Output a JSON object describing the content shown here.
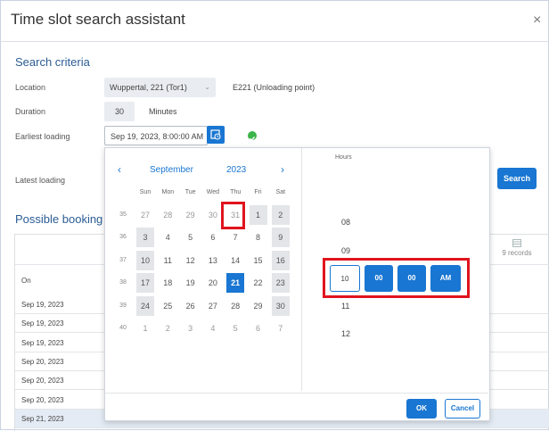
{
  "dialog": {
    "title": "Time slot search assistant",
    "close": "×"
  },
  "criteria": {
    "heading": "Search criteria",
    "location_label": "Location",
    "location_value": "Wuppertal, 221 (Tor1)",
    "location_desc": "E221 (Unloading point)",
    "duration_label": "Duration",
    "duration_value": "30",
    "duration_unit": "Minutes",
    "earliest_label": "Earliest loading",
    "earliest_value": "Sep 19, 2023, 8:00:00 AM",
    "latest_label": "Latest loading",
    "search_label": "Search"
  },
  "results": {
    "heading": "Possible booking t",
    "col_on": "On",
    "records": "9 records",
    "rows": [
      "Sep 19, 2023",
      "Sep 19, 2023",
      "Sep 19, 2023",
      "Sep 20, 2023",
      "Sep 20, 2023",
      "Sep 20, 2023",
      "Sep 21, 2023"
    ]
  },
  "calendar": {
    "prev": "‹",
    "next": "›",
    "month": "September",
    "year": "2023",
    "weekdays": [
      "Sun",
      "Mon",
      "Tue",
      "Wed",
      "Thu",
      "Fri",
      "Sat"
    ],
    "weeks": [
      {
        "no": "35",
        "days": [
          "27",
          "28",
          "29",
          "30",
          "31",
          "1",
          "2"
        ]
      },
      {
        "no": "36",
        "days": [
          "3",
          "4",
          "5",
          "6",
          "7",
          "8",
          "9"
        ]
      },
      {
        "no": "37",
        "days": [
          "10",
          "11",
          "12",
          "13",
          "14",
          "15",
          "16"
        ]
      },
      {
        "no": "38",
        "days": [
          "17",
          "18",
          "19",
          "20",
          "21",
          "22",
          "23"
        ]
      },
      {
        "no": "39",
        "days": [
          "24",
          "25",
          "26",
          "27",
          "28",
          "29",
          "30"
        ]
      },
      {
        "no": "40",
        "days": [
          "1",
          "2",
          "3",
          "4",
          "5",
          "6",
          "7"
        ]
      }
    ]
  },
  "time": {
    "hours_label": "Hours",
    "hours_above": [
      "08",
      "09"
    ],
    "hours_below": [
      "11",
      "12"
    ],
    "hour": "10",
    "minute": "00",
    "second": "00",
    "ampm": "AM"
  },
  "buttons": {
    "ok": "OK",
    "cancel": "Cancel"
  },
  "colors": {
    "accent": "#1976d2",
    "highlight": "#e0141e",
    "valid": "#3bb44a"
  }
}
